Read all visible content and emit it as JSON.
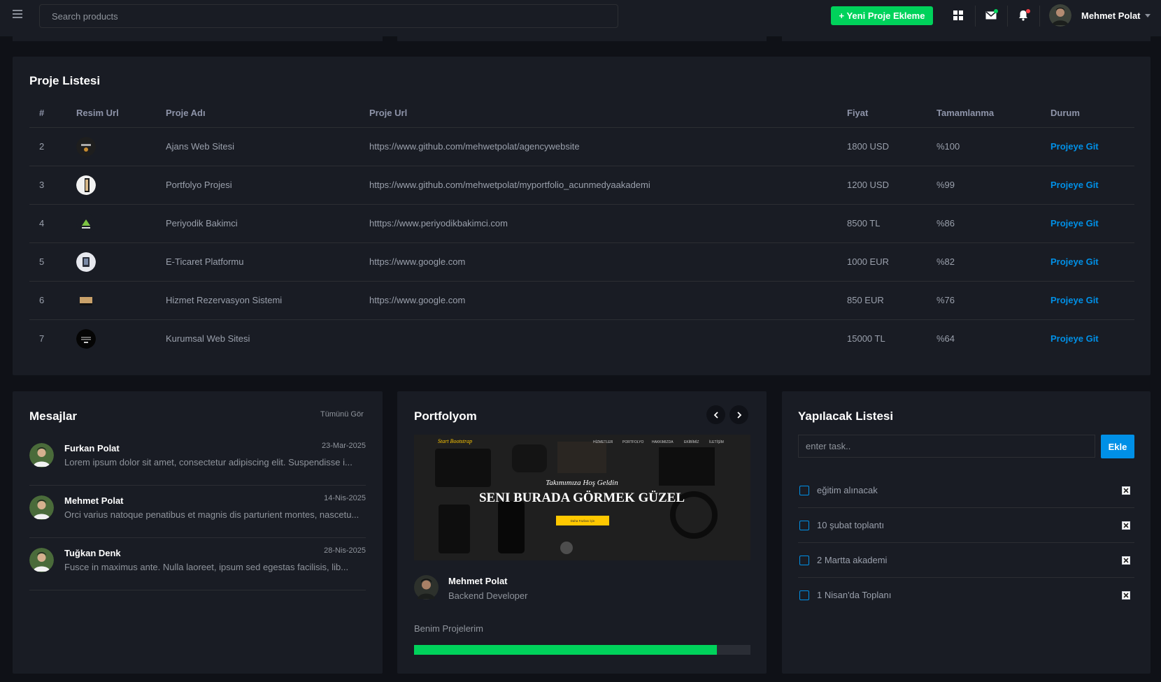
{
  "header": {
    "search_placeholder": "Search products",
    "new_project_label": "+ Yeni Proje Ekleme",
    "user_name": "Mehmet Polat"
  },
  "projects": {
    "title": "Proje Listesi",
    "columns": [
      "#",
      "Resim Url",
      "Proje Adı",
      "Proje Url",
      "Fiyat",
      "Tamamlanma",
      "Durum"
    ],
    "rows": [
      {
        "id": "2",
        "name": "Ajans Web Sitesi",
        "url": "https://www.github.com/mehwetpolat/agencywebsite",
        "price": "1800 USD",
        "completion": "%100",
        "status": "Projeye Git"
      },
      {
        "id": "3",
        "name": "Portfolyo Projesi",
        "url": "https://www.github.com/mehwetpolat/myportfolio_acunmedyaakademi",
        "price": "1200 USD",
        "completion": "%99",
        "status": "Projeye Git"
      },
      {
        "id": "4",
        "name": "Periyodik Bakimci",
        "url": "htttps://www.periyodikbakimci.com",
        "price": "8500 TL",
        "completion": "%86",
        "status": "Projeye Git"
      },
      {
        "id": "5",
        "name": "E-Ticaret Platformu",
        "url": "https://www.google.com",
        "price": "1000 EUR",
        "completion": "%82",
        "status": "Projeye Git"
      },
      {
        "id": "6",
        "name": "Hizmet Rezervasyon Sistemi",
        "url": "https://www.google.com",
        "price": "850 EUR",
        "completion": "%76",
        "status": "Projeye Git"
      },
      {
        "id": "7",
        "name": "Kurumsal Web Sitesi",
        "url": "",
        "price": "15000 TL",
        "completion": "%64",
        "status": "Projeye Git"
      }
    ]
  },
  "messages": {
    "title": "Mesajlar",
    "view_all": "Tümünü Gör",
    "items": [
      {
        "name": "Furkan Polat",
        "date": "23-Mar-2025",
        "text": "Lorem ipsum dolor sit amet, consectetur adipiscing elit. Suspendisse i..."
      },
      {
        "name": "Mehmet Polat",
        "date": "14-Nis-2025",
        "text": "Orci varius natoque penatibus et magnis dis parturient montes, nascetu..."
      },
      {
        "name": "Tuğkan Denk",
        "date": "28-Nis-2025",
        "text": "Fusce in maximus ante. Nulla laoreet, ipsum sed egestas facilisis, lib..."
      }
    ]
  },
  "portfolio": {
    "title": "Portfolyom",
    "hero": {
      "brand": "Start Bootstrap",
      "nav": [
        "HİZMETLER",
        "PORTFOLYO",
        "HAKKIMIZDA",
        "EKİBİMİZ",
        "İLETİŞİM"
      ],
      "subtitle": "Takımımıza Hoş Geldin",
      "headline": "SENI BURADA GÖRMEK GÜZEL",
      "cta": "Daha Fazlası İçin"
    },
    "name": "Mehmet Polat",
    "role": "Backend Developer",
    "progress_label": "Benim Projelerim",
    "progress_percent": 90
  },
  "todo": {
    "title": "Yapılacak Listesi",
    "input_placeholder": "enter task..",
    "add_label": "Ekle",
    "items": [
      "eğitim alınacak",
      "10 şubat toplantı",
      "2 Martta akademi",
      "1 Nisan'da Toplanı"
    ]
  },
  "colors": {
    "background": "#0f1117",
    "card": "#191c24",
    "success": "#00d25b",
    "primary": "#0090e7",
    "danger": "#fc424a"
  }
}
